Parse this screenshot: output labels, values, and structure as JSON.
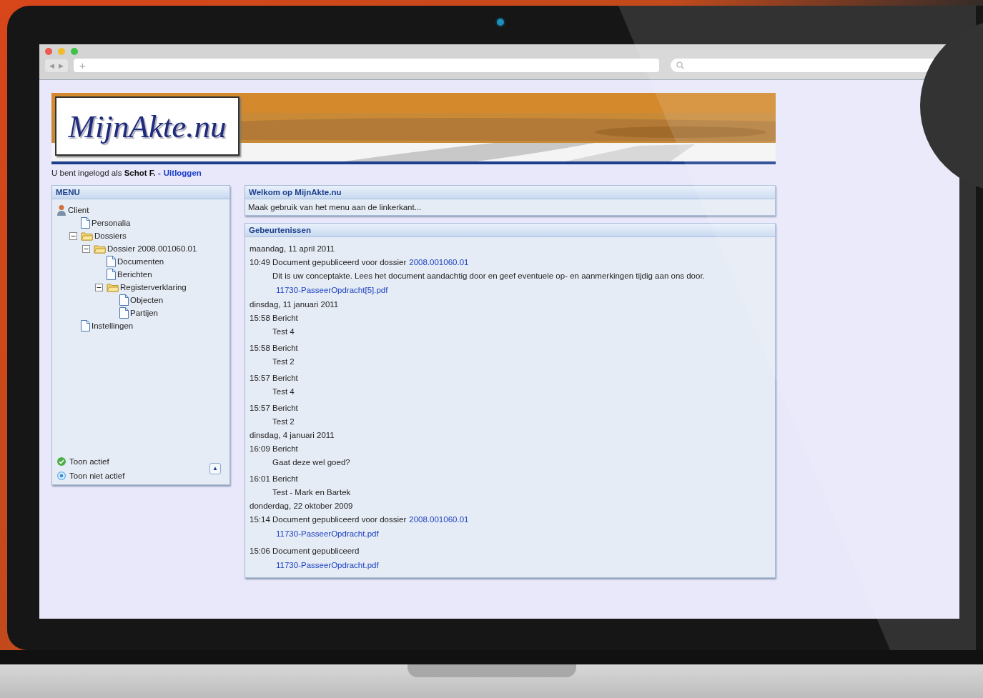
{
  "browser": {
    "toolbar": {
      "back_icon": "◀",
      "forward_icon": "▶",
      "new_tab": "+"
    }
  },
  "site": {
    "logo": "MijnAkte.nu",
    "login": {
      "prefix": "U bent ingelogd als",
      "user": "Schot F.",
      "separator": "-",
      "logout": "Uitloggen"
    },
    "menu": {
      "title": "MENU",
      "tree": [
        {
          "label": "Client",
          "kind": "client",
          "children": [
            {
              "label": "Personalia",
              "kind": "page"
            },
            {
              "label": "Dossiers",
              "kind": "folder",
              "expanded": true,
              "children": [
                {
                  "label": "Dossier 2008.001060.01",
                  "kind": "folder",
                  "expanded": true,
                  "children": [
                    {
                      "label": "Documenten",
                      "kind": "page"
                    },
                    {
                      "label": "Berichten",
                      "kind": "page"
                    },
                    {
                      "label": "Registerverklaring",
                      "kind": "folder",
                      "expanded": true,
                      "children": [
                        {
                          "label": "Objecten",
                          "kind": "page"
                        },
                        {
                          "label": "Partijen",
                          "kind": "page"
                        }
                      ]
                    }
                  ]
                }
              ]
            },
            {
              "label": "Instellingen",
              "kind": "page"
            }
          ]
        }
      ],
      "legend": [
        {
          "label": "Toon actief",
          "kind": "active"
        },
        {
          "label": "Toon niet actief",
          "kind": "inactive"
        }
      ],
      "collapse_icon": "▲"
    },
    "welcome": {
      "title": "Welkom op MijnAkte.nu",
      "text": "Maak gebruik van het menu aan de linkerkant..."
    },
    "events": {
      "title": "Gebeurtenissen",
      "days": [
        {
          "date": "maandag, 11 april 2011",
          "entries": [
            {
              "time": "10:49",
              "title": "Document gepubliceerd voor dossier",
              "link": "2008.001060.01",
              "details": [
                {
                  "kind": "text",
                  "text": "Dit is uw conceptakte. Lees het document aandachtig door en geef eventuele op- en aanmerkingen tijdig aan ons door."
                },
                {
                  "kind": "link",
                  "text": "11730-PasseerOpdracht[5].pdf"
                }
              ]
            }
          ]
        },
        {
          "date": "dinsdag, 11 januari 2011",
          "entries": [
            {
              "time": "15:58",
              "title": "Bericht",
              "details": [
                {
                  "kind": "text",
                  "text": "Test 4"
                }
              ]
            },
            {
              "time": "15:58",
              "title": "Bericht",
              "details": [
                {
                  "kind": "text",
                  "text": "Test 2"
                }
              ]
            },
            {
              "time": "15:57",
              "title": "Bericht",
              "details": [
                {
                  "kind": "text",
                  "text": "Test 4"
                }
              ]
            },
            {
              "time": "15:57",
              "title": "Bericht",
              "details": [
                {
                  "kind": "text",
                  "text": "Test 2"
                }
              ]
            }
          ]
        },
        {
          "date": "dinsdag, 4 januari 2011",
          "entries": [
            {
              "time": "16:09",
              "title": "Bericht",
              "details": [
                {
                  "kind": "text",
                  "text": "Gaat deze wel goed?"
                }
              ]
            },
            {
              "time": "16:01",
              "title": "Bericht",
              "details": [
                {
                  "kind": "text",
                  "text": "Test - Mark en Bartek"
                }
              ]
            }
          ]
        },
        {
          "date": "donderdag, 22 oktober 2009",
          "entries": [
            {
              "time": "15:14",
              "title": "Document gepubliceerd voor dossier",
              "link": "2008.001060.01",
              "details": [
                {
                  "kind": "link",
                  "text": "11730-PasseerOpdracht.pdf"
                }
              ]
            },
            {
              "time": "15:06",
              "title": "Document gepubliceerd",
              "details": [
                {
                  "kind": "link",
                  "text": "11730-PasseerOpdracht.pdf"
                }
              ]
            }
          ]
        }
      ]
    }
  }
}
